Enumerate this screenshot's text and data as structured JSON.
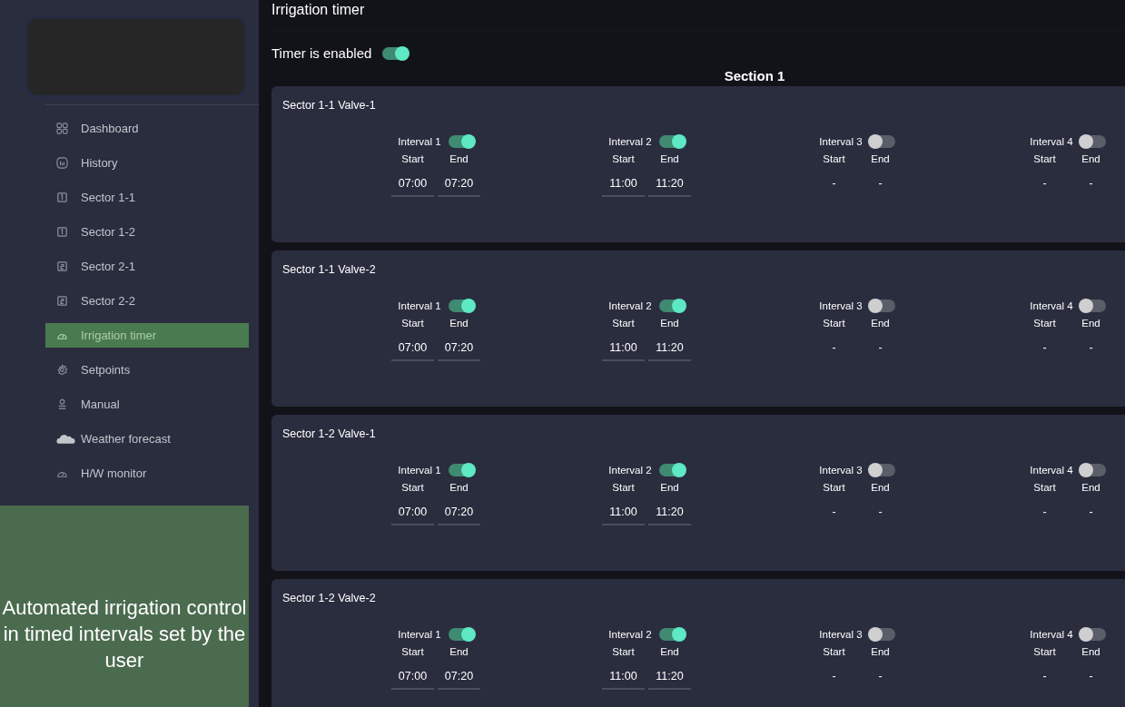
{
  "sidebar": {
    "items": [
      {
        "label": "Dashboard",
        "selected": false
      },
      {
        "label": "History",
        "selected": false
      },
      {
        "label": "Sector 1-1",
        "selected": false
      },
      {
        "label": "Sector 1-2",
        "selected": false
      },
      {
        "label": "Sector 2-1",
        "selected": false
      },
      {
        "label": "Sector 2-2",
        "selected": false
      },
      {
        "label": "Irrigation timer",
        "selected": true
      },
      {
        "label": "Setpoints",
        "selected": false
      },
      {
        "label": "Manual",
        "selected": false
      },
      {
        "label": "Weather forecast",
        "selected": false
      },
      {
        "label": "H/W monitor",
        "selected": false
      }
    ]
  },
  "caption": "Automated irrigation control in timed intervals set by the user",
  "page_title": "Irrigation timer",
  "timer": {
    "label": "Timer is enabled",
    "on": true
  },
  "section_title": "Section 1",
  "valves": [
    {
      "name": "Sector 1-1 Valve-1",
      "intervals": [
        {
          "label": "Interval 1",
          "on": true,
          "start_label": "Start",
          "end_label": "End",
          "start": "07:00",
          "end": "07:20"
        },
        {
          "label": "Interval 2",
          "on": true,
          "start_label": "Start",
          "end_label": "End",
          "start": "11:00",
          "end": "11:20"
        },
        {
          "label": "Interval 3",
          "on": false,
          "start_label": "Start",
          "end_label": "End",
          "start": "-",
          "end": "-"
        },
        {
          "label": "Interval 4",
          "on": false,
          "start_label": "Start",
          "end_label": "End",
          "start": "-",
          "end": "-"
        }
      ]
    },
    {
      "name": "Sector 1-1 Valve-2",
      "intervals": [
        {
          "label": "Interval 1",
          "on": true,
          "start_label": "Start",
          "end_label": "End",
          "start": "07:00",
          "end": "07:20"
        },
        {
          "label": "Interval 2",
          "on": true,
          "start_label": "Start",
          "end_label": "End",
          "start": "11:00",
          "end": "11:20"
        },
        {
          "label": "Interval 3",
          "on": false,
          "start_label": "Start",
          "end_label": "End",
          "start": "-",
          "end": "-"
        },
        {
          "label": "Interval 4",
          "on": false,
          "start_label": "Start",
          "end_label": "End",
          "start": "-",
          "end": "-"
        }
      ]
    },
    {
      "name": "Sector 1-2 Valve-1",
      "intervals": [
        {
          "label": "Interval 1",
          "on": true,
          "start_label": "Start",
          "end_label": "End",
          "start": "07:00",
          "end": "07:20"
        },
        {
          "label": "Interval 2",
          "on": true,
          "start_label": "Start",
          "end_label": "End",
          "start": "11:00",
          "end": "11:20"
        },
        {
          "label": "Interval 3",
          "on": false,
          "start_label": "Start",
          "end_label": "End",
          "start": "-",
          "end": "-"
        },
        {
          "label": "Interval 4",
          "on": false,
          "start_label": "Start",
          "end_label": "End",
          "start": "-",
          "end": "-"
        }
      ]
    },
    {
      "name": "Sector 1-2 Valve-2",
      "intervals": [
        {
          "label": "Interval 1",
          "on": true,
          "start_label": "Start",
          "end_label": "End",
          "start": "07:00",
          "end": "07:20"
        },
        {
          "label": "Interval 2",
          "on": true,
          "start_label": "Start",
          "end_label": "End",
          "start": "11:00",
          "end": "11:20"
        },
        {
          "label": "Interval 3",
          "on": false,
          "start_label": "Start",
          "end_label": "End",
          "start": "-",
          "end": "-"
        },
        {
          "label": "Interval 4",
          "on": false,
          "start_label": "Start",
          "end_label": "End",
          "start": "-",
          "end": "-"
        }
      ]
    }
  ]
}
